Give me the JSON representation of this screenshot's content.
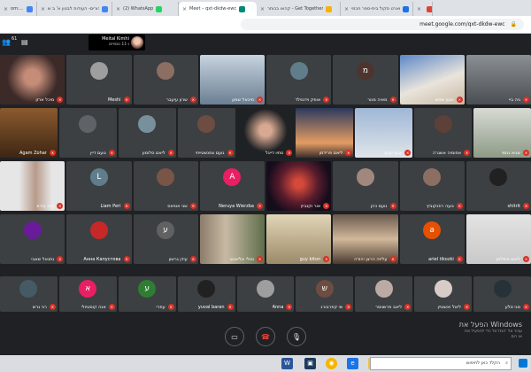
{
  "tabs": [
    {
      "label": "om:... - ",
      "color": "#4285f4"
    },
    {
      "label": "ים הורים- העודות לבטון א' ב ש..",
      "color": "#4285f4"
    },
    {
      "label": "(2) WhatsApp",
      "color": "#25d366"
    },
    {
      "label": "Meet – qxt-dkdw-ewc",
      "color": "#00897b",
      "active": true
    },
    {
      "label": "קהאו בכותר - Get Together",
      "color": "#f4b400"
    },
    {
      "label": "סמארט סקול בית-ספר חכמי",
      "color": "#1a73e8"
    },
    {
      "label": "",
      "color": "#db4437"
    }
  ],
  "address": {
    "url": "meet.google.com/qxt-dkdw-ewc"
  },
  "header": {
    "participant_count": "61",
    "presenter_name": "Meital Kimhi",
    "presenter_sub": "ו-11 נוספים"
  },
  "tiles": [
    {
      "name": "ניה ביי",
      "type": "video",
      "bg": "linear-gradient(180deg,#8a8f94,#4a4e52)"
    },
    {
      "name": "יונטן שמש",
      "type": "video",
      "bg": "linear-gradient(160deg,#5c88c7,#e9e4dc 55%,#c9b9a2)"
    },
    {
      "name": "מאיה מנור",
      "type": "avatar",
      "letter": "מ",
      "color": "#4e342e"
    },
    {
      "name": "אופק וידנפלד",
      "type": "photo",
      "color": "#607d8b"
    },
    {
      "name": "מיכאל שמע",
      "type": "video",
      "bg": "linear-gradient(180deg,#c7d3df,#6b7f93)"
    },
    {
      "name": "שרון עיעבר",
      "type": "photo",
      "color": "#8d6e63"
    },
    {
      "name": "Meshi",
      "type": "photo",
      "color": "#9e9e9e"
    },
    {
      "name": "מיכל ארזן",
      "type": "video",
      "bg": "radial-gradient(circle at 50% 45%,#c58c78 18%,#3b2a28 60%)"
    },
    {
      "name": "שגיא נחמי",
      "type": "video",
      "bg": "linear-gradient(180deg,#d7dbd4,#8e9a86)"
    },
    {
      "name": "אפומיה אשגרה",
      "type": "photo",
      "color": "#5d4037"
    },
    {
      "name": "אגם יעקב",
      "type": "video",
      "bg": "linear-gradient(180deg,#9fb7d6,#dfe5ea)"
    },
    {
      "name": "ליאם פרידמן",
      "type": "video",
      "bg": "linear-gradient(180deg,#2b3a5e,#e49c62 70%,#3a2e2e)"
    },
    {
      "name": "סתיו דייגל",
      "type": "video",
      "bg": "radial-gradient(circle at 50% 45%,#d8a892 15%,#1f2224 55%)"
    },
    {
      "name": "נועם צפנשטייחי",
      "type": "photo",
      "color": "#6d4c41"
    },
    {
      "name": "ליאם סלומון",
      "type": "photo",
      "color": "#78909c"
    },
    {
      "name": "נועם דיין",
      "type": "avatar",
      "letter": "",
      "color": "#5f6368"
    },
    {
      "name": "Agam Zohar",
      "type": "video",
      "bg": "linear-gradient(180deg,#8a5a2e,#3e2613)"
    },
    {
      "name": "shitrit",
      "type": "photo",
      "color": "#212121"
    },
    {
      "name": "נועה רוזנקוביץ",
      "type": "photo",
      "color": "#8d6e63"
    },
    {
      "name": "נועם כהן",
      "type": "photo",
      "color": "#a1887f"
    },
    {
      "name": "אור וקנביץ",
      "type": "video",
      "bg": "radial-gradient(circle at 50% 45%,#d44a3a 10%,#5a1c2c 45%,#150d1c 75%)"
    },
    {
      "name": "Neruya Wierzba",
      "type": "avatar",
      "letter": "A",
      "color": "#e91e63"
    },
    {
      "name": "שני אטיאס",
      "type": "photo",
      "color": "#795548"
    },
    {
      "name": "Liam Peri",
      "type": "avatar",
      "letter": "L",
      "color": "#607d8b"
    },
    {
      "name": "דנה בורא",
      "type": "video",
      "bg": "linear-gradient(90deg,#e6e6e6 30%,#b79a8a 55%,#e6e6e6 80%)"
    },
    {
      "name": "ליאם פיסלמן",
      "type": "video",
      "bg": "linear-gradient(180deg,#e3e3e3,#c9c9c9)"
    },
    {
      "name": "ariel tikozki",
      "type": "avatar",
      "letter": "a",
      "color": "#e65100"
    },
    {
      "name": "עליזה הרצן יהודה",
      "type": "video",
      "bg": "linear-gradient(180deg,#6a5a4e,#d1b89a 50%,#4a3a30)"
    },
    {
      "name": "guy biton",
      "type": "video",
      "bg": "linear-gradient(180deg,#e2d6b8,#9b8a6a)"
    },
    {
      "name": "נטלי אליאנוב",
      "type": "video",
      "bg": "linear-gradient(90deg,#8c7d6a,#c7b9a4 40%,#5e6e4a)"
    },
    {
      "name": "עידן גרשון",
      "type": "avatar",
      "letter": "ע",
      "color": "#616161"
    },
    {
      "name": "Анна Капустова",
      "type": "photo",
      "color": "#c62828"
    },
    {
      "name": "נתנאל שאבי",
      "type": "photo",
      "color": "#6a1b9a"
    },
    {
      "name": "מגי סלע",
      "type": "photo",
      "color": "#263238"
    },
    {
      "name": "ליאל וינשטיין",
      "type": "photo",
      "color": "#d7ccc8"
    },
    {
      "name": "ליאב פרשווסר",
      "type": "photo",
      "color": "#bcaaa4"
    },
    {
      "name": "שי קפרבורג",
      "type": "avatar",
      "letter": "ש",
      "color": "#6d4c41"
    },
    {
      "name": "Anna",
      "type": "photo",
      "color": "#9e9e9e"
    },
    {
      "name": "yuval baran",
      "type": "photo",
      "color": "#212121"
    },
    {
      "name": "עפרי",
      "type": "avatar",
      "letter": "ע",
      "color": "#2e7d32"
    },
    {
      "name": "אנה קוסטיולי",
      "type": "avatar",
      "letter": "א",
      "color": "#e91e63"
    },
    {
      "name": "רני גרש",
      "type": "photo",
      "color": "#455a64"
    }
  ],
  "watermark": {
    "title": "הפעל את Windows",
    "line1": "עבור אל 'הגדרות' כדי להפעיל את",
    "line2": "או רום"
  },
  "controls": {
    "camera": "▭",
    "hangup": "☎",
    "mic": "🎙"
  },
  "taskbar": {
    "search_placeholder": "הקלד כאן לחיפוש"
  },
  "colors": {
    "background": "#202124",
    "mic_off": "#d93025",
    "tile": "#3c4043"
  }
}
